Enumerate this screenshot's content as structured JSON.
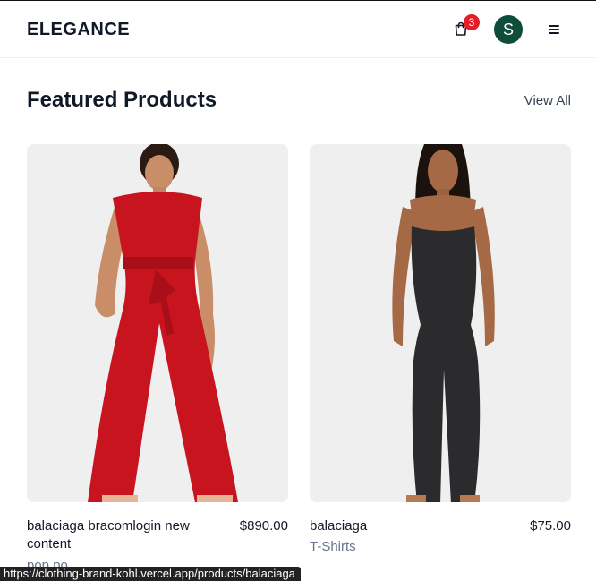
{
  "header": {
    "brand": "ELEGANCE",
    "cart_count": "3",
    "avatar_initial": "S",
    "icons": {
      "cart": "shopping-bag-icon",
      "menu": "hamburger-menu-icon"
    },
    "colors": {
      "badge": "#e11d2a",
      "avatar": "#0f4d3a"
    }
  },
  "section": {
    "title": "Featured Products",
    "view_all": "View All"
  },
  "products": [
    {
      "name": "balaciaga bracomlogin new content",
      "price": "$890.00",
      "category": "pop po",
      "image_desc": "model-red-jumpsuit"
    },
    {
      "name": "balaciaga",
      "price": "$75.00",
      "category": "T-Shirts",
      "image_desc": "model-black-bodysuit"
    }
  ],
  "status_bar": {
    "url": "https://clothing-brand-kohl.vercel.app/products/balaciaga"
  }
}
